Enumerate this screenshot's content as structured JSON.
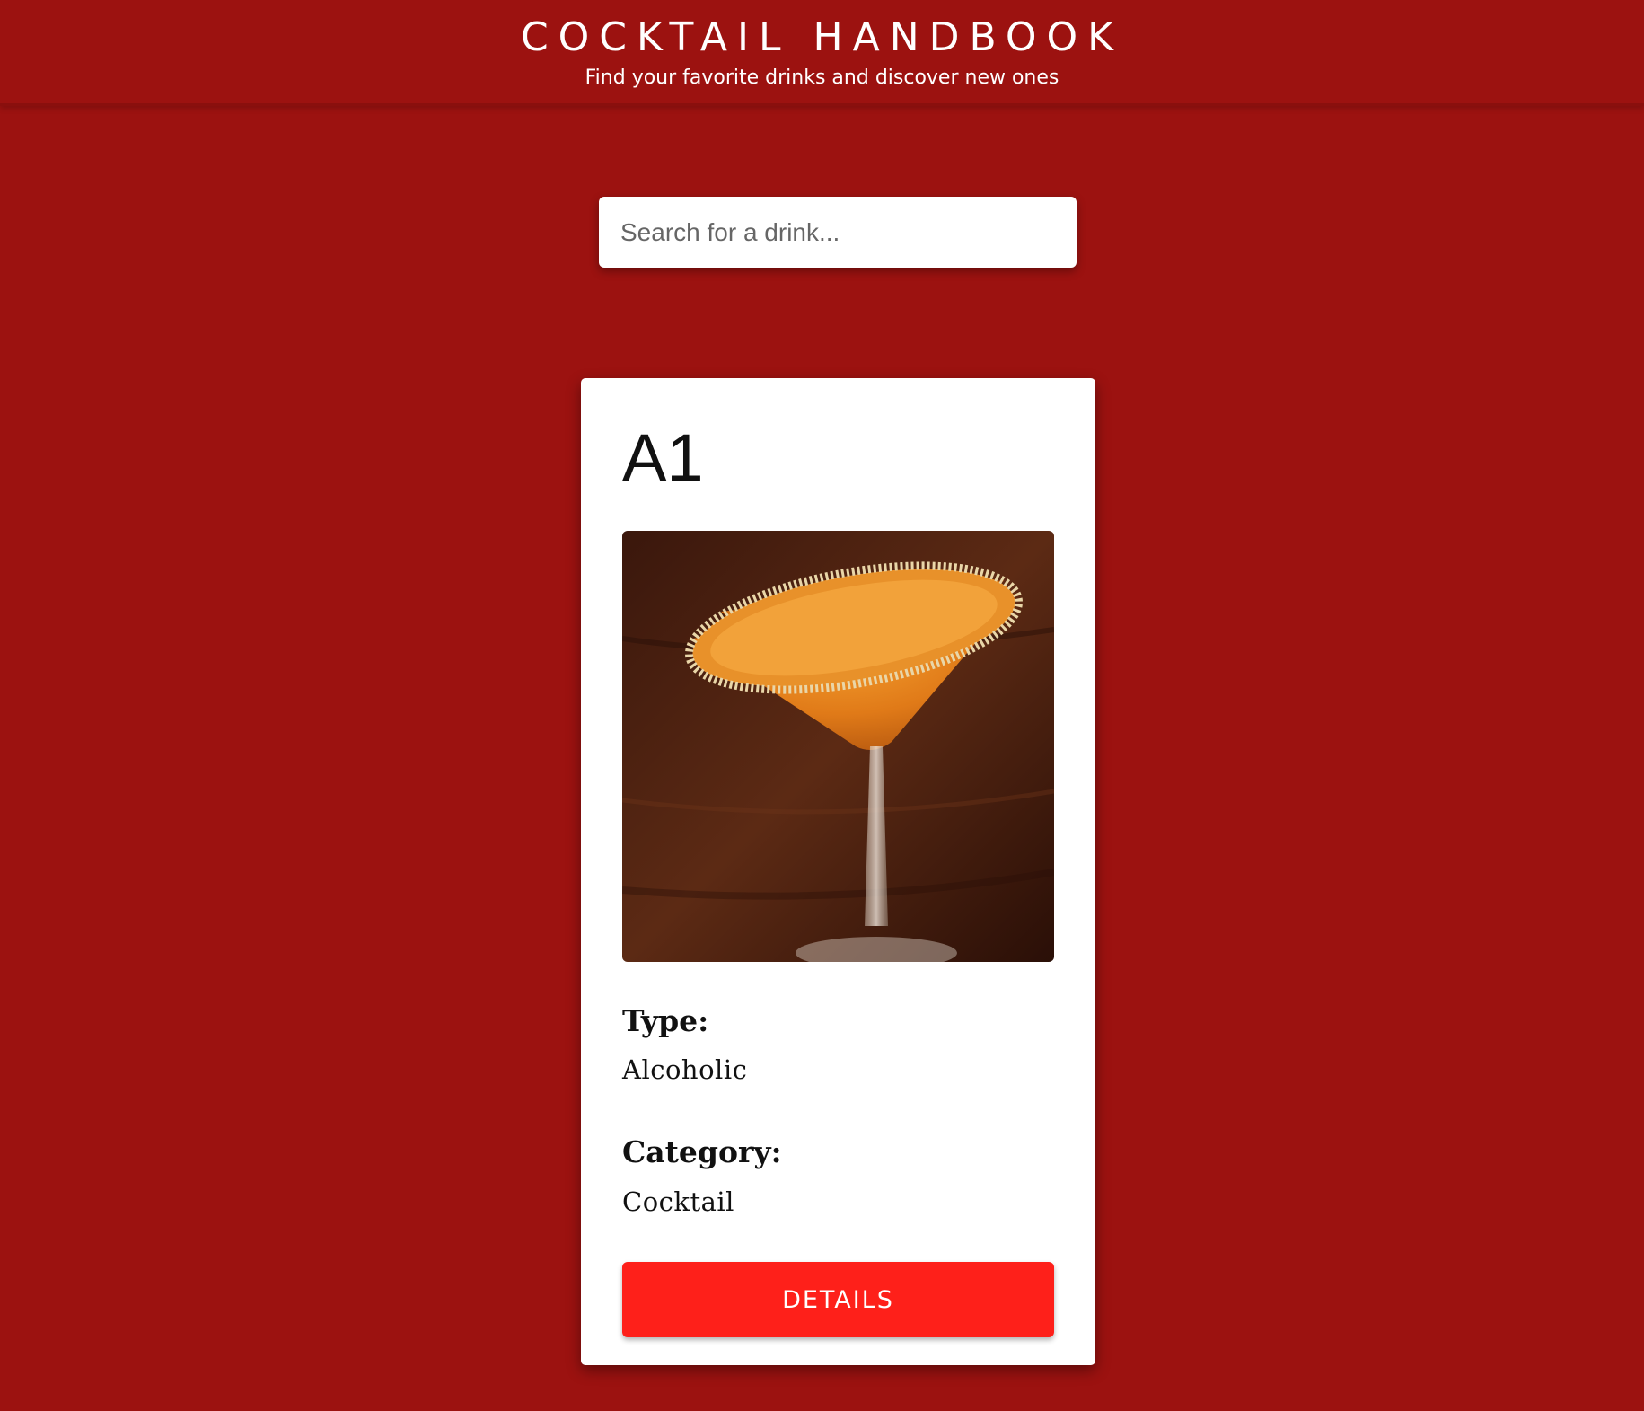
{
  "header": {
    "title": "COCKTAIL HANDBOOK",
    "subtitle": "Find your favorite drinks and discover new ones"
  },
  "search": {
    "placeholder": "Search for a drink...",
    "value": ""
  },
  "card": {
    "name": "A1",
    "type_label": "Type:",
    "type_value": "Alcoholic",
    "category_label": "Category:",
    "category_value": "Cocktail",
    "details_label": "DETAILS"
  },
  "colors": {
    "background": "#9c1210",
    "card": "#ffffff",
    "button": "#fe201a"
  }
}
